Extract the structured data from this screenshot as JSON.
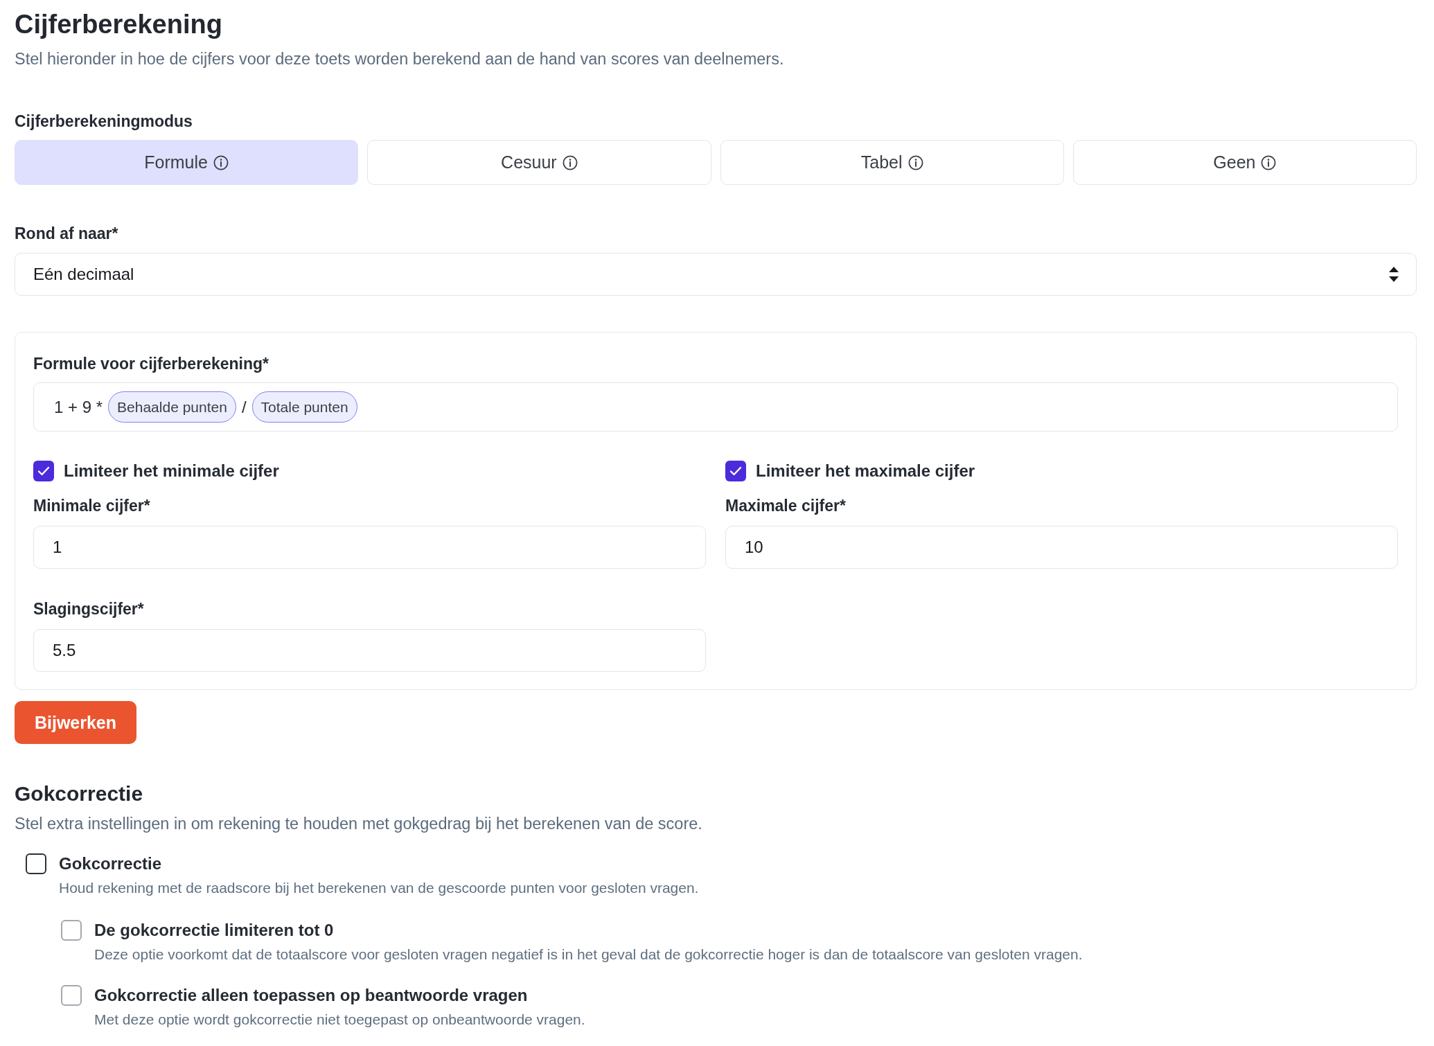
{
  "header": {
    "title": "Cijferberekening",
    "subtitle": "Stel hieronder in hoe de cijfers voor deze toets worden berekend aan de hand van scores van deelnemers."
  },
  "mode": {
    "label": "Cijferberekeningmodus",
    "tabs": [
      {
        "label": "Formule",
        "selected": true
      },
      {
        "label": "Cesuur",
        "selected": false
      },
      {
        "label": "Tabel",
        "selected": false
      },
      {
        "label": "Geen",
        "selected": false
      }
    ]
  },
  "rounding": {
    "label": "Rond af naar*",
    "value": "Eén decimaal"
  },
  "formula_card": {
    "formula": {
      "label": "Formule voor cijferberekening*",
      "tokens": [
        {
          "kind": "text",
          "text": "1 + 9 *"
        },
        {
          "kind": "chip",
          "text": "Behaalde punten"
        },
        {
          "kind": "text",
          "text": "/"
        },
        {
          "kind": "chip",
          "text": "Totale punten"
        }
      ]
    },
    "limits": [
      {
        "checkbox_label": "Limiteer het minimale cijfer",
        "checked": true,
        "field_label": "Minimale cijfer*",
        "value": "1"
      },
      {
        "checkbox_label": "Limiteer het maximale cijfer",
        "checked": true,
        "field_label": "Maximale cijfer*",
        "value": "10"
      }
    ],
    "passing_grade": {
      "label": "Slagingscijfer*",
      "value": "5.5"
    }
  },
  "update_button": "Bijwerken",
  "guess_correction": {
    "title": "Gokcorrectie",
    "subtitle": "Stel extra instellingen in om rekening te houden met gokgedrag bij het berekenen van de score.",
    "options": [
      {
        "label": "Gokcorrectie",
        "description": "Houd rekening met de raadscore bij het berekenen van de gescoorde punten voor gesloten vragen.",
        "checked": false,
        "disabled": false,
        "children": [
          {
            "label": "De gokcorrectie limiteren tot 0",
            "description": "Deze optie voorkomt dat de totaalscore voor gesloten vragen negatief is in het geval dat de gokcorrectie hoger is dan de totaalscore van gesloten vragen.",
            "checked": false,
            "disabled": true
          },
          {
            "label": "Gokcorrectie alleen toepassen op beantwoorde vragen",
            "description": "Met deze optie wordt gokcorrectie niet toegepast op onbeantwoorde vragen.",
            "checked": false,
            "disabled": true
          }
        ]
      }
    ]
  }
}
